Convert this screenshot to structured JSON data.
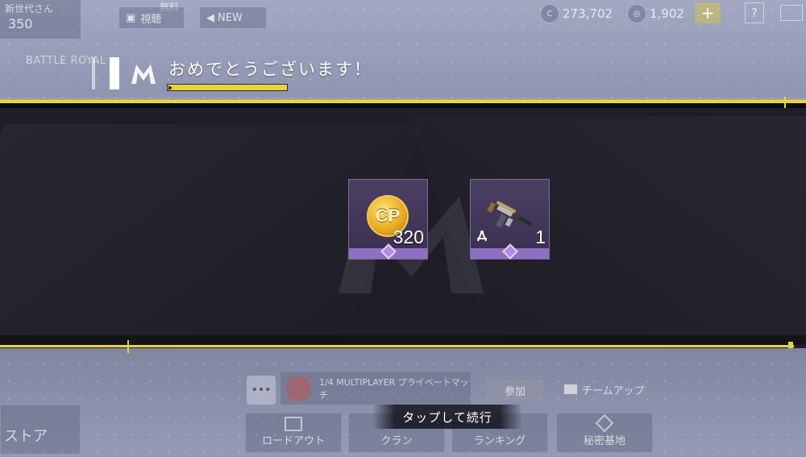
{
  "hud": {
    "player_name": "新世代さん",
    "level": "350",
    "free_label": "無料",
    "live_label": "視聴",
    "new_label": "NEW",
    "cp_amount": "273,702",
    "cod_points": "1,902",
    "plus_label": "+",
    "help_label": "?",
    "mode_label": "BATTLE ROYAL"
  },
  "reward": {
    "title": "おめでとうございます！",
    "items": [
      {
        "name": "CP",
        "icon": "cp-coin-icon",
        "quantity": "320"
      },
      {
        "name": "weapon-blueprint",
        "icon": "gun-icon",
        "quantity": "1"
      }
    ]
  },
  "bottom": {
    "store_label": "ストア",
    "lobby_text": "1/4 MULTIPLAYER プライベートマッチ",
    "join_label": "参加",
    "team_up_label": "チームアップ",
    "loadout_label": "ロードアウト",
    "clan_label": "クラン",
    "ranking_label": "ランキング",
    "base_label": "秘密基地",
    "tap_continue": "タップして続行"
  },
  "colors": {
    "accent_yellow": "#e8d53b",
    "panel_dark": "#1e1e26",
    "rarity_purple": "#8f6fc3"
  }
}
